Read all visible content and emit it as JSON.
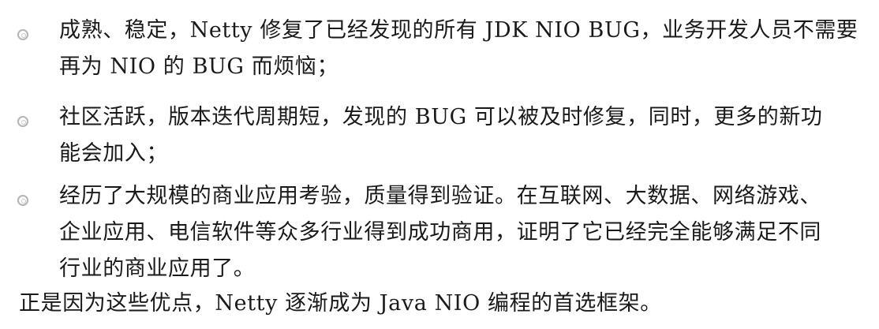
{
  "bullets": [
    {
      "lines": [
        "成熟、稳定，Netty 修复了已经发现的所有 JDK NIO BUG，业务开发人员不需要",
        "再为 NIO 的 BUG 而烦恼；"
      ]
    },
    {
      "lines": [
        "社区活跃，版本迭代周期短，发现的 BUG 可以被及时修复，同时，更多的新功",
        "能会加入；"
      ]
    },
    {
      "lines": [
        "经历了大规模的商业应用考验，质量得到验证。在互联网、大数据、网络游戏、",
        "企业应用、电信软件等众多行业得到成功商用，证明了它已经完全能够满足不同",
        "行业的商业应用了。"
      ]
    }
  ],
  "summary": "正是因为这些优点，Netty 逐渐成为 Java NIO 编程的首选框架。"
}
